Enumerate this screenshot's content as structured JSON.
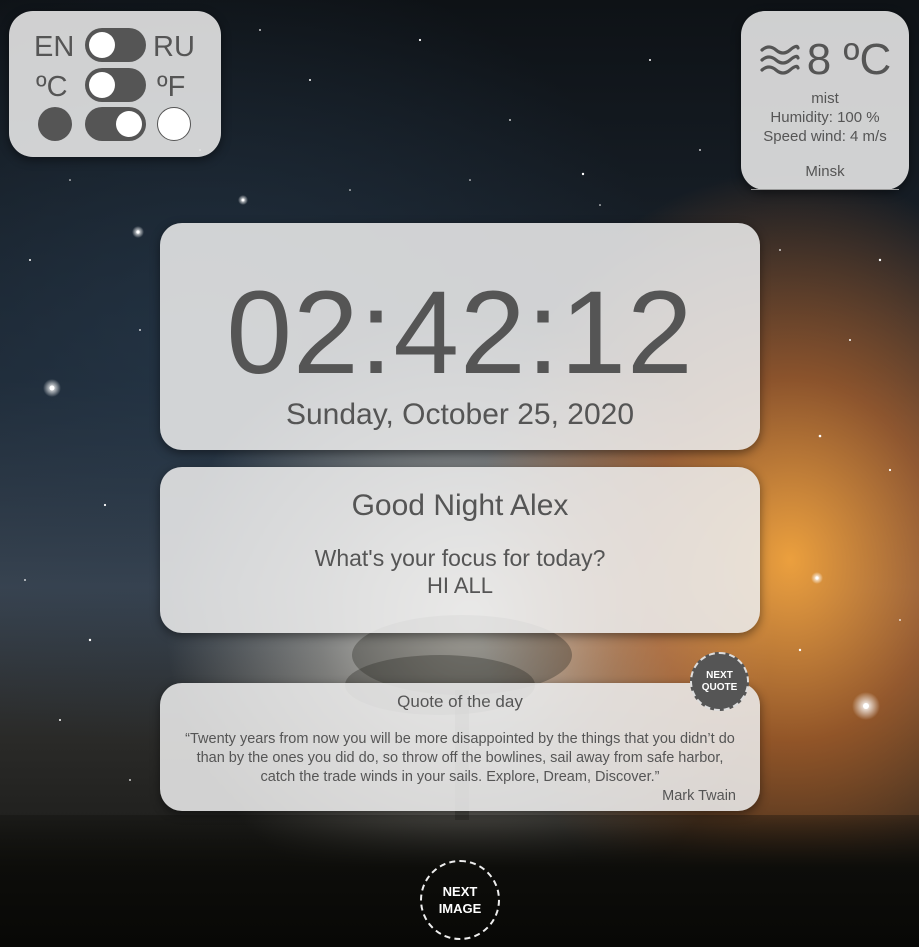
{
  "settings": {
    "lang_left": "EN",
    "lang_right": "RU",
    "unit_left": "ºC",
    "unit_right": "ºF",
    "language": "EN",
    "unit": "ºC",
    "theme_colors": [
      "#555555",
      "#ffffff"
    ],
    "theme": "light"
  },
  "weather": {
    "icon": "mist-icon",
    "temperature": "8 ºC",
    "description": "mist",
    "humidity": "Humidity: 100 %",
    "wind": "Speed wind: 4 m/s",
    "city": "Minsk"
  },
  "clock": {
    "time": "02:42:12",
    "date": "Sunday, October 25, 2020"
  },
  "greeting": {
    "text": "Good Night Alex",
    "focus_question": "What's your focus for today?",
    "focus_answer": "HI ALL"
  },
  "quote": {
    "title": "Quote of the day",
    "text": "“Twenty years from now you will be more disappointed by the things that you didn’t do than by the ones you did do, so throw off the bowlines, sail away from safe harbor, catch the trade winds in your sails. Explore, Dream, Discover.”",
    "author": "Mark Twain",
    "next_label_1": "NEXT",
    "next_label_2": "QUOTE"
  },
  "background": {
    "next_label_1": "NEXT",
    "next_label_2": "IMAGE"
  }
}
